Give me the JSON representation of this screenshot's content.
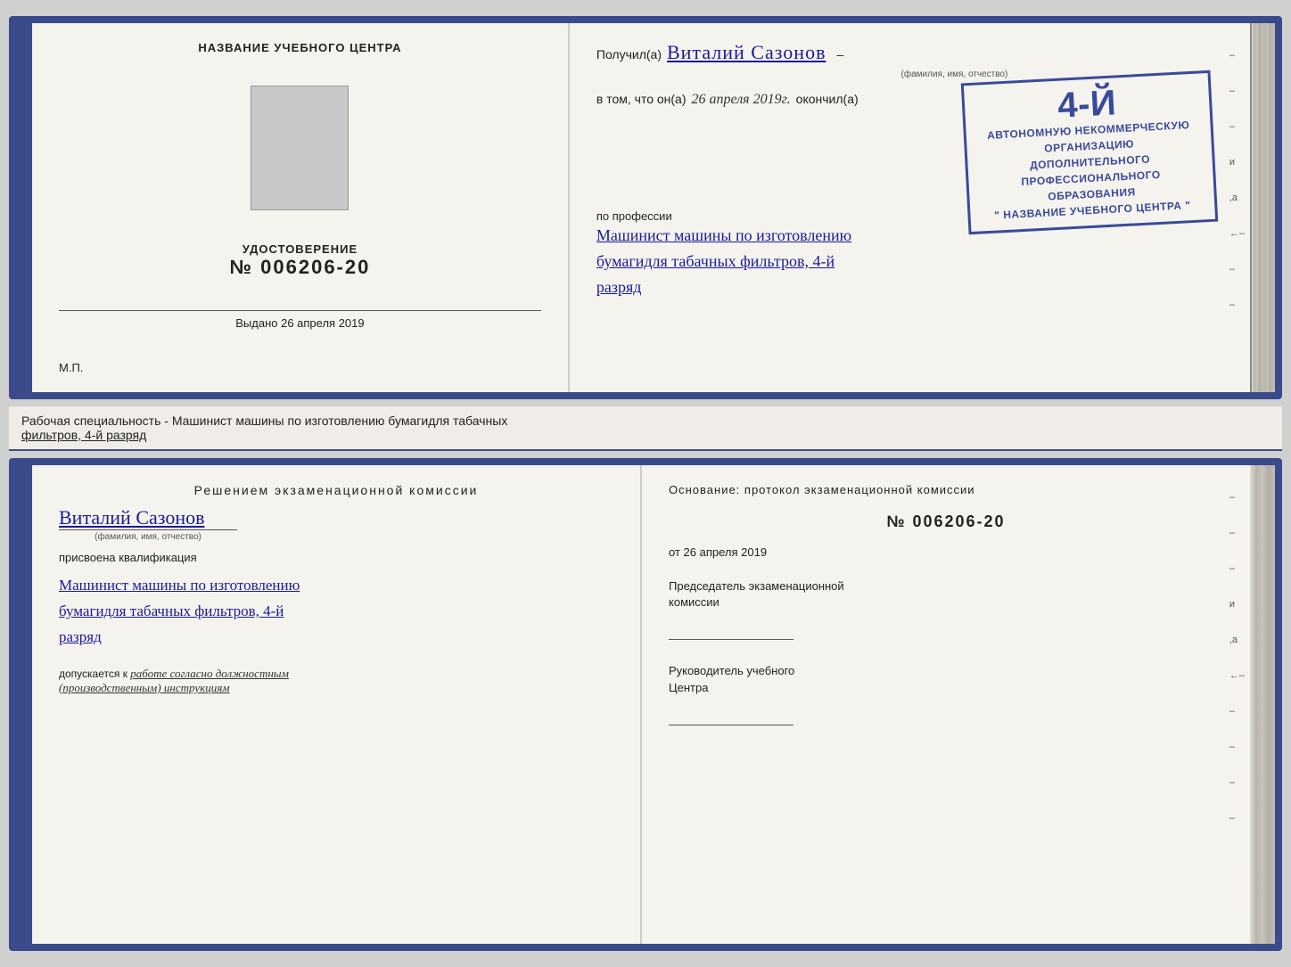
{
  "top_left": {
    "center_title": "НАЗВАНИЕ УЧЕБНОГО ЦЕНТРА",
    "cert_label": "УДОСТОВЕРЕНИЕ",
    "cert_number": "№ 006206-20",
    "issued_text": "Выдано 26 апреля 2019",
    "mp_text": "М.П."
  },
  "top_right": {
    "received_prefix": "Получил(а)",
    "recipient_name": "Виталий Сазонов",
    "fio_label": "(фамилия, имя, отчество)",
    "in_that_prefix": "в том, что он(а)",
    "date_handwritten": "26 апреля 2019г.",
    "finished_text": "окончил(а)",
    "stamp_line1": "4-й",
    "stamp_line2": "АВТОНОМНУЮ НЕКОММЕРЧЕСКУЮ ОРГАНИЗАЦИЮ",
    "stamp_line3": "ДОПОЛНИТЕЛЬНОГО ПРОФЕССИОНАЛЬНОГО ОБРАЗОВАНИЯ",
    "stamp_line4": "\" НАЗВАНИЕ УЧЕБНОГО ЦЕНТРА \"",
    "profession_label": "по профессии",
    "profession_text1": "Машинист машины по изготовлению",
    "profession_text2": "бумагидля табачных фильтров, 4-й",
    "profession_text3": "разряд"
  },
  "middle": {
    "text": "Рабочая специальность - Машинист машины по изготовлению бумагидля табачных",
    "text2": "фильтров, 4-й разряд"
  },
  "bottom_left": {
    "commission_title": "Решением  экзаменационной  комиссии",
    "person_name": "Виталий Сазонов",
    "fio_label": "(фамилия, имя, отчество)",
    "assigned_label": "присвоена квалификация",
    "qualification1": "Машинист машины по изготовлению",
    "qualification2": "бумагидля табачных фильтров, 4-й",
    "qualification3": "разряд",
    "allowed_prefix": "допускается к",
    "allowed_text": "работе согласно должностным",
    "allowed_text2": "(производственным) инструкциям"
  },
  "bottom_right": {
    "basis_label": "Основание: протокол экзаменационной  комиссии",
    "protocol_number": "№  006206-20",
    "date_prefix": "от",
    "date_value": "26 апреля 2019",
    "chairman_label": "Председатель экзаменационной",
    "commission_word": "комиссии",
    "director_label": "Руководитель учебного",
    "center_word": "Центра"
  },
  "right_marks": [
    "-",
    "-",
    "-",
    "и",
    ",а",
    "←",
    "-",
    "-",
    "-",
    "-"
  ]
}
